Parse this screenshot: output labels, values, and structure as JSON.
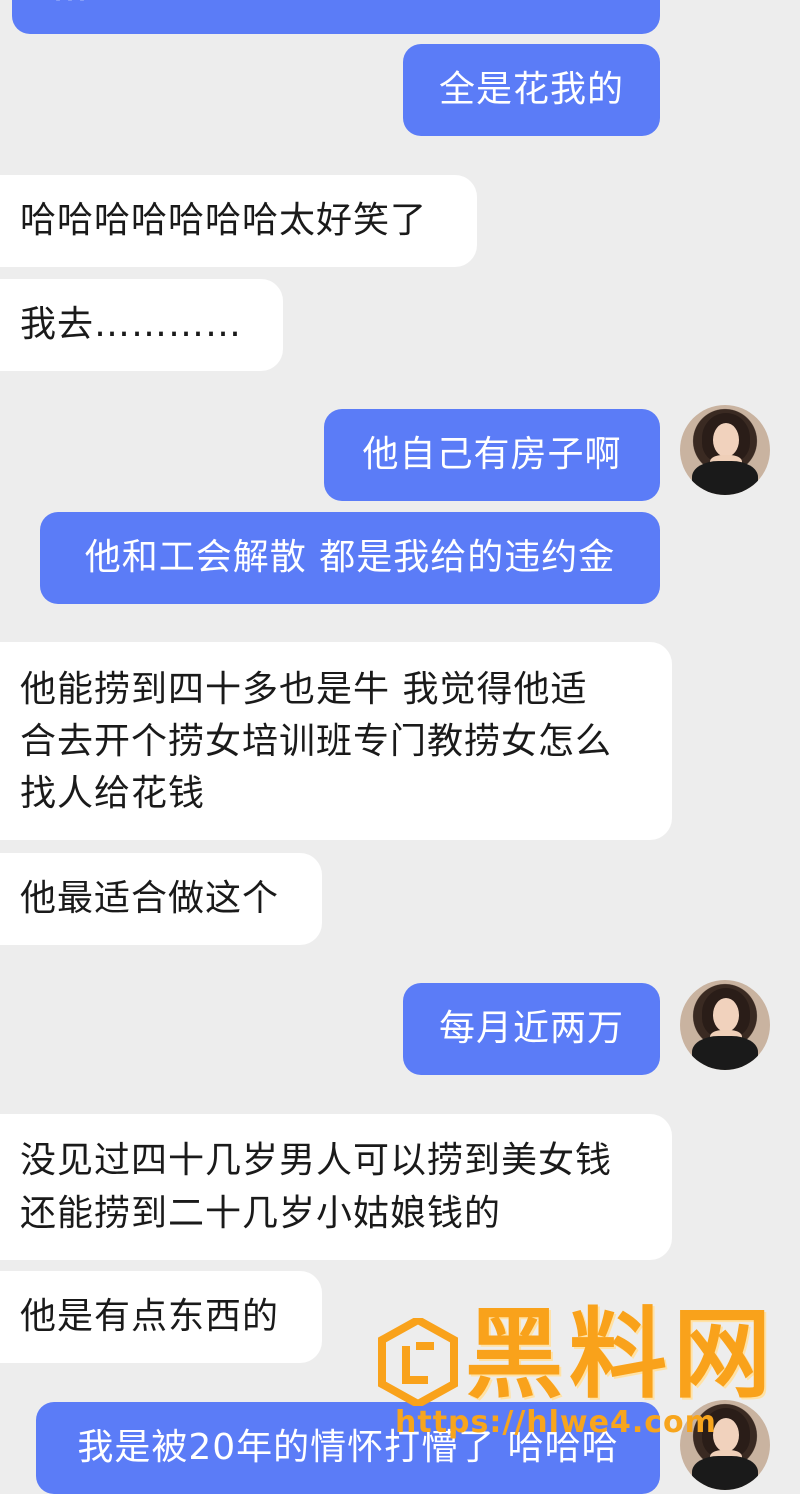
{
  "messages": [
    {
      "side": "out",
      "text": "…"
    },
    {
      "side": "out",
      "text": "全是花我的"
    },
    {
      "side": "in",
      "lines": [
        "哈哈哈哈哈哈哈太好笑了"
      ]
    },
    {
      "side": "in",
      "lines": [
        "我去…………"
      ]
    },
    {
      "side": "out",
      "text": "他自己有房子啊"
    },
    {
      "side": "out",
      "text": "他和工会解散 都是我给的违约金"
    },
    {
      "side": "in",
      "lines": [
        "他能捞到四十多也是牛 我觉得他适",
        "合去开个捞女培训班专门教捞女怎么",
        "找人给花钱"
      ]
    },
    {
      "side": "in",
      "lines": [
        "他最适合做这个"
      ]
    },
    {
      "side": "out",
      "text": "每月近两万"
    },
    {
      "side": "in",
      "lines": [
        "没见过四十几岁男人可以捞到美女钱",
        "还能捞到二十几岁小姑娘钱的"
      ]
    },
    {
      "side": "in",
      "lines": [
        "他是有点东西的"
      ]
    },
    {
      "side": "out",
      "text": "我是被20年的情怀打懵了 哈哈哈"
    }
  ],
  "watermark": {
    "title": "黑料网",
    "url": "https://hlwe4.com"
  },
  "colors": {
    "background": "#ededed",
    "outgoing_bubble": "#5b7cf7",
    "incoming_bubble": "#ffffff",
    "watermark": "#f9a21b"
  }
}
